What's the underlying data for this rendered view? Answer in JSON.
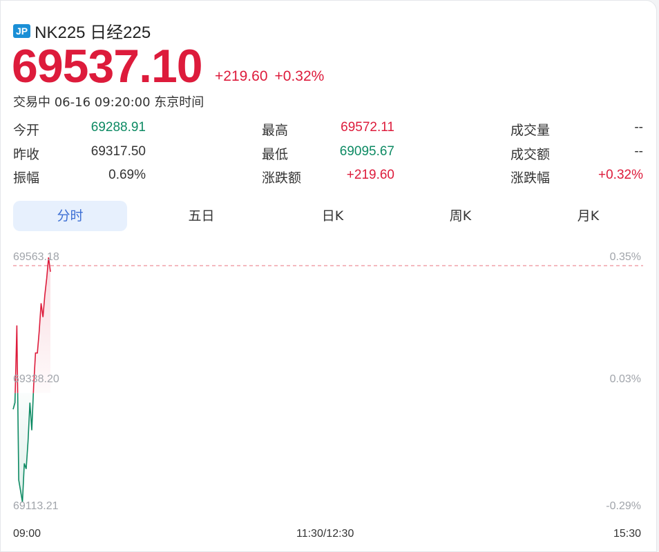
{
  "header": {
    "flag": "JP",
    "title": "NK225 日经225",
    "price": "69537.10",
    "change": "+219.60",
    "change_pct": "+0.32%",
    "status": "交易中 06-16 09:20:00 东京时间"
  },
  "stats": [
    {
      "label": "今开",
      "value": "69288.91",
      "color": "green"
    },
    {
      "label": "最高",
      "value": "69572.11",
      "color": "red"
    },
    {
      "label": "成交量",
      "value": "--",
      "color": "dark"
    },
    {
      "label": "昨收",
      "value": "69317.50",
      "color": "dark"
    },
    {
      "label": "最低",
      "value": "69095.67",
      "color": "green"
    },
    {
      "label": "成交额",
      "value": "--",
      "color": "dark"
    },
    {
      "label": "振幅",
      "value": "0.69%",
      "color": "dark"
    },
    {
      "label": "涨跌额",
      "value": "+219.60",
      "color": "red"
    },
    {
      "label": "涨跌幅",
      "value": "+0.32%",
      "color": "red"
    }
  ],
  "tabs": [
    "分时",
    "五日",
    "日K",
    "周K",
    "月K"
  ],
  "active_tab": 0,
  "chart": {
    "y_left": [
      "69563.18",
      "69338.20",
      "69113.21"
    ],
    "y_right": [
      "0.35%",
      "0.03%",
      "-0.29%"
    ],
    "x_labels": [
      "09:00",
      "11:30/12:30",
      "15:30"
    ],
    "colors": {
      "up": "#dd1b3b",
      "down": "#0d8a63",
      "ref": "#e8737f"
    }
  },
  "chart_data": {
    "type": "line",
    "ylim": [
      69113.21,
      69563.18
    ],
    "reference": 69317.5,
    "x": [
      "09:00",
      "09:01",
      "09:02",
      "09:03",
      "09:04",
      "09:05",
      "09:06",
      "09:07",
      "09:08",
      "09:09",
      "09:10",
      "09:11",
      "09:12",
      "09:13",
      "09:14",
      "09:15",
      "09:16",
      "09:17",
      "09:18",
      "09:19",
      "09:20"
    ],
    "values": [
      69288,
      69300,
      69440,
      69160,
      69140,
      69120,
      69190,
      69180,
      69230,
      69300,
      69250,
      69330,
      69390,
      69390,
      69430,
      69480,
      69455,
      69495,
      69525,
      69563,
      69537
    ]
  }
}
